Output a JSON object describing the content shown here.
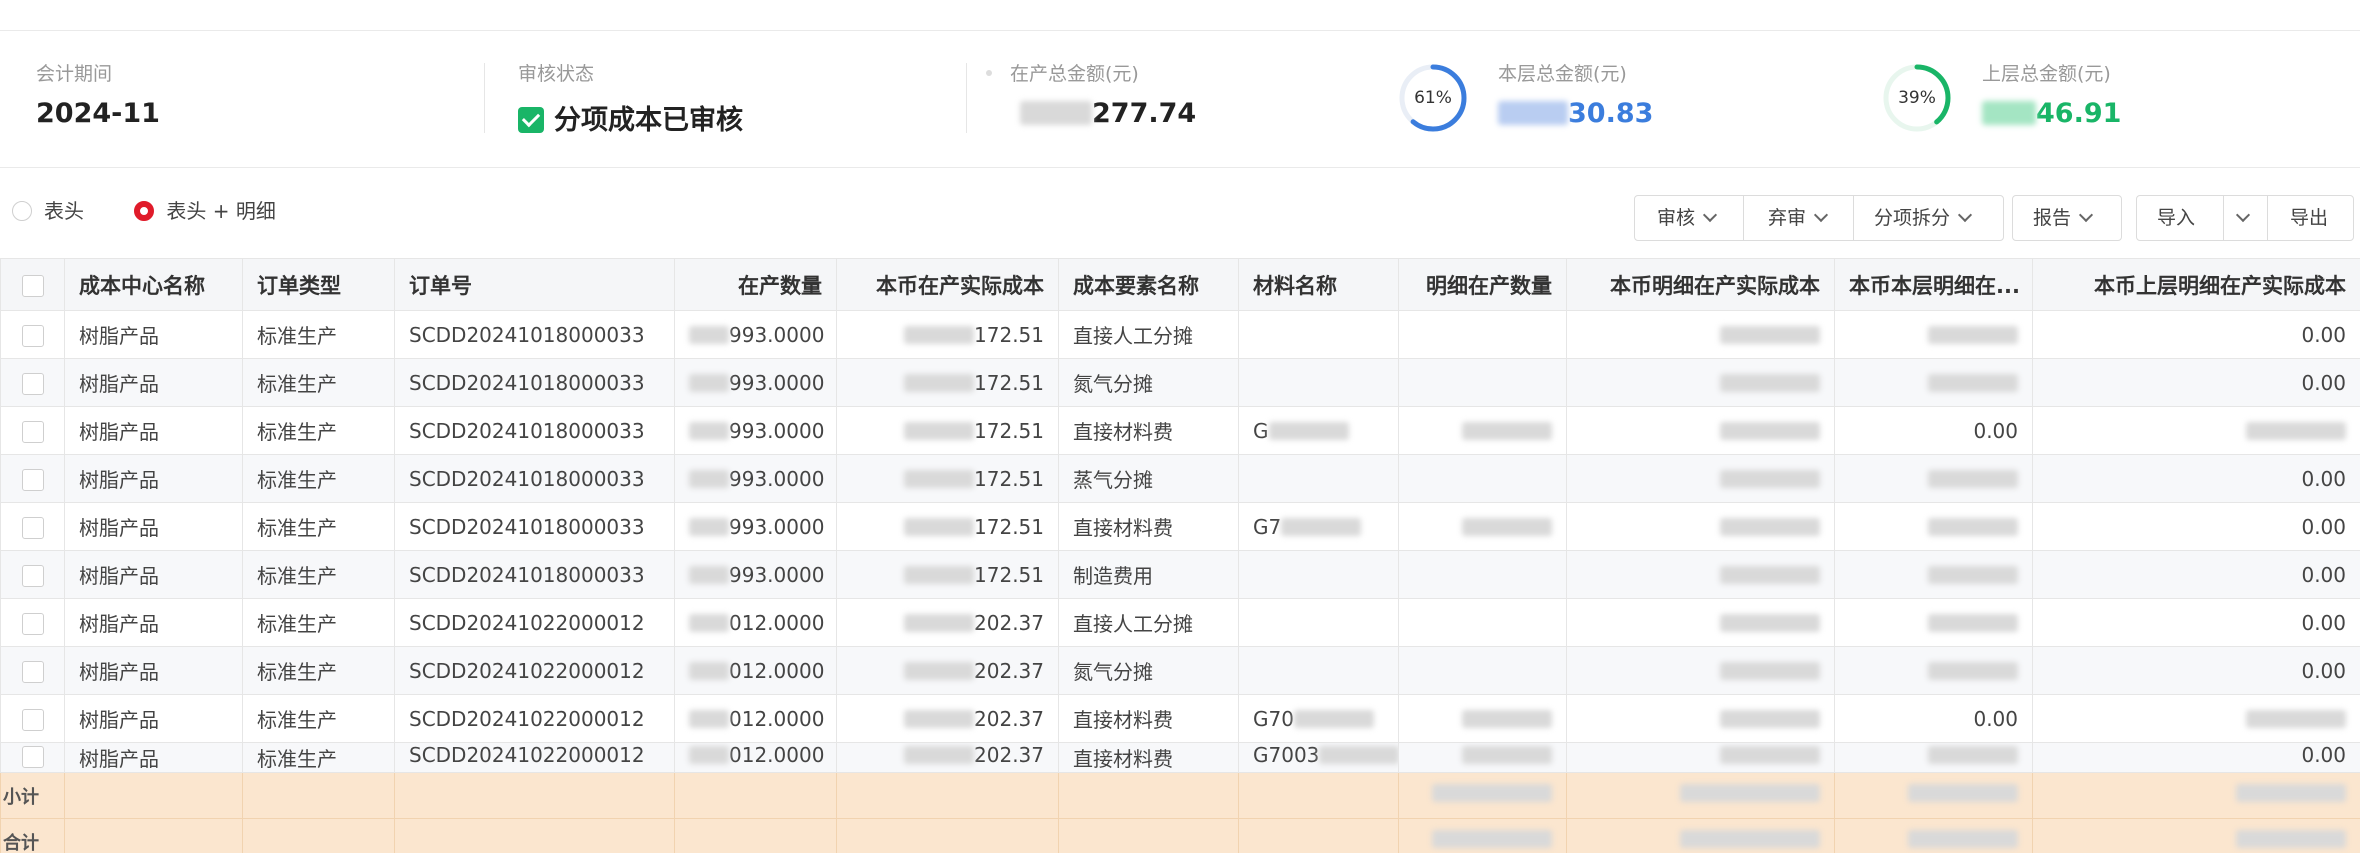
{
  "summary": {
    "period_label": "会计期间",
    "period_value": "2024-11",
    "review_label": "审核状态",
    "review_value": "分项成本已审核",
    "wip_total_label": "在产总金额(元)",
    "wip_total_value": "277.74",
    "current_layer_label": "本层总金额(元)",
    "current_layer_value": "30.83",
    "current_layer_percent": "61%",
    "current_layer_ratio": 0.61,
    "upper_layer_label": "上层总金额(元)",
    "upper_layer_value": "46.91",
    "upper_layer_percent": "39%",
    "upper_layer_ratio": 0.39,
    "colors": {
      "current_layer": "#3b7ddd",
      "upper_layer": "#19b567",
      "reviewed_check": "#19b567"
    }
  },
  "view_mode": {
    "options": [
      "表头",
      "表头 + 明细"
    ],
    "selected": "表头 + 明细"
  },
  "toolbar": {
    "review": "审核",
    "unreview": "弃审",
    "split": "分项拆分",
    "report": "报告",
    "import": "导入",
    "export": "导出"
  },
  "table": {
    "columns": [
      "成本中心名称",
      "订单类型",
      "订单号",
      "在产数量",
      "本币在产实际成本",
      "成本要素名称",
      "材料名称",
      "明细在产数量",
      "本币明细在产实际成本",
      "本币本层明细在...",
      "本币上层明细在产实际成本"
    ],
    "rows": [
      [
        "树脂产品",
        "标准生产",
        "SCDD20241018000033",
        "993.0000",
        "172.51",
        "直接人工分摊",
        "",
        "",
        "",
        "",
        "0.00"
      ],
      [
        "树脂产品",
        "标准生产",
        "SCDD20241018000033",
        "993.0000",
        "172.51",
        "氮气分摊",
        "",
        "",
        "",
        "",
        "0.00"
      ],
      [
        "树脂产品",
        "标准生产",
        "SCDD20241018000033",
        "993.0000",
        "172.51",
        "直接材料费",
        "G",
        "",
        "",
        "0.00",
        ""
      ],
      [
        "树脂产品",
        "标准生产",
        "SCDD20241018000033",
        "993.0000",
        "172.51",
        "蒸气分摊",
        "",
        "",
        "",
        "",
        "0.00"
      ],
      [
        "树脂产品",
        "标准生产",
        "SCDD20241018000033",
        "993.0000",
        "172.51",
        "直接材料费",
        "G7",
        "",
        "",
        "",
        "0.00"
      ],
      [
        "树脂产品",
        "标准生产",
        "SCDD20241018000033",
        "993.0000",
        "172.51",
        "制造费用",
        "",
        "",
        "",
        "",
        "0.00"
      ],
      [
        "树脂产品",
        "标准生产",
        "SCDD20241022000012",
        "012.0000",
        "202.37",
        "直接人工分摊",
        "",
        "",
        "",
        "",
        "0.00"
      ],
      [
        "树脂产品",
        "标准生产",
        "SCDD20241022000012",
        "012.0000",
        "202.37",
        "氮气分摊",
        "",
        "",
        "",
        "",
        "0.00"
      ],
      [
        "树脂产品",
        "标准生产",
        "SCDD20241022000012",
        "012.0000",
        "202.37",
        "直接材料费",
        "G70",
        "",
        "",
        "0.00",
        ""
      ],
      [
        "树脂产品",
        "标准生产",
        "SCDD20241022000012",
        "012.0000",
        "202.37",
        "直接材料费",
        "G7003",
        "",
        "",
        "",
        "0.00"
      ]
    ],
    "subtotal_label": "小计",
    "total_label": "合计"
  }
}
